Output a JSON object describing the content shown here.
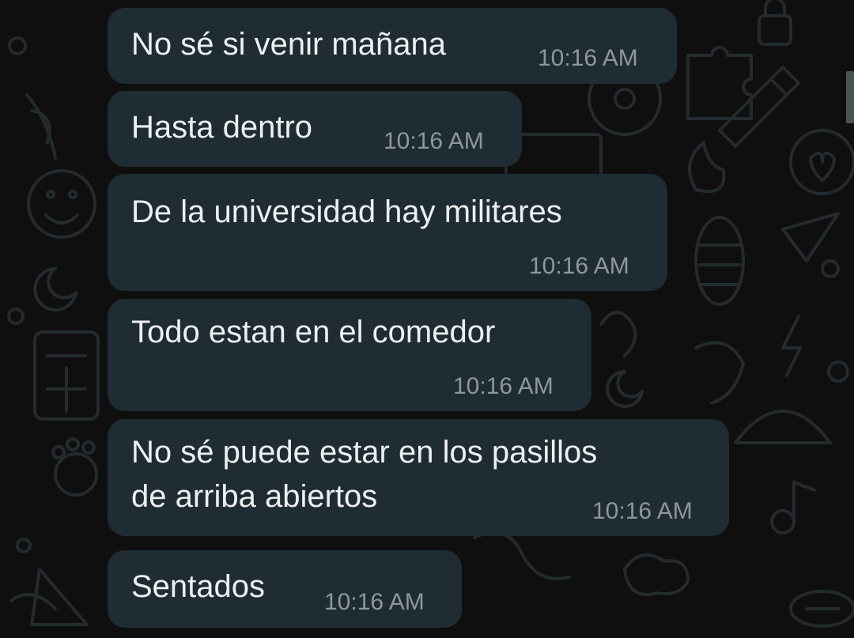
{
  "colors": {
    "background": "#0f0f0f",
    "bubble": "#1f2c33",
    "message_text": "#eceff1",
    "timestamp": "#8d979c",
    "wallpaper_doodle": "#242b2f"
  },
  "messages": [
    {
      "text": "No sé si venir mañana",
      "time": "10:16 AM"
    },
    {
      "text": "Hasta dentro",
      "time": "10:16 AM"
    },
    {
      "text": "De la universidad hay militares",
      "time": "10:16 AM"
    },
    {
      "text": "Todo estan en el comedor",
      "time": "10:16 AM"
    },
    {
      "text_line1": "No sé puede estar en los pasillos",
      "text_line2": "de arriba abiertos",
      "time": "10:16 AM"
    },
    {
      "text": "Sentados",
      "time": "10:16 AM"
    }
  ]
}
